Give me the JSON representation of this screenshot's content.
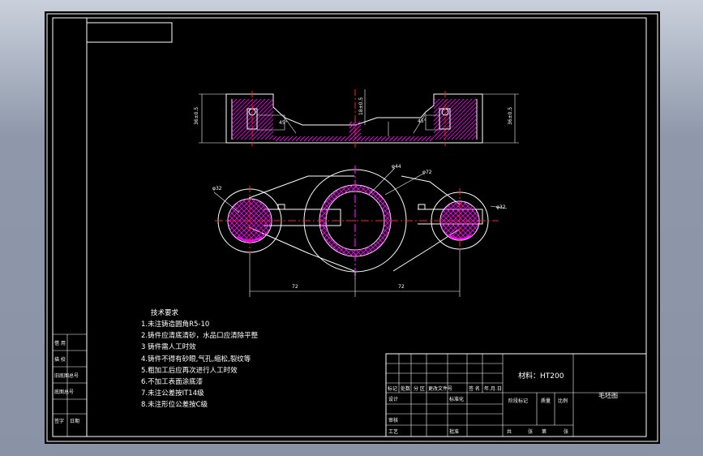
{
  "drawing": {
    "dimensions": {
      "left_height": "36±0.5",
      "center_height": "18±0.5",
      "right_height": "36±0.5",
      "angle_left": "45°",
      "angle_right": "45°",
      "phi_left": "φ32",
      "phi_right": "φ32",
      "phi_center_inner": "φ44",
      "phi_center_outer": "φ72",
      "span_left": "72",
      "span_right": "72"
    }
  },
  "tech": {
    "title": "技术要求",
    "items": [
      "1.未注铸造圆角R5-10",
      "2.铸件应清底清砂，水品口应清除平整",
      "3 铸件需人工时效",
      "4.铸件不得有砂眼,气孔,缩松,裂纹等",
      "5.粗加工后应再次进行人工时效",
      "6.不加工表面涂底漆",
      "7.未注公差按IT14级",
      "8.未注形位公差按C级"
    ]
  },
  "titleblock": {
    "material": "材料：HT200",
    "part_name": "毛坯图",
    "left_cells": [
      "借  用",
      "描  校",
      "旧底图总号",
      "底图总号",
      "签字",
      "日期"
    ],
    "row_labels": [
      "标记",
      "处数",
      "分 区",
      "更改文件号",
      "签 名",
      "年.月.日"
    ],
    "roles": [
      "设计",
      "标准化",
      "审核",
      "工艺",
      "批准"
    ],
    "stage": [
      "阶段标记",
      "质量",
      "比例"
    ],
    "sheet": [
      "共",
      "张",
      "第",
      "张"
    ]
  }
}
